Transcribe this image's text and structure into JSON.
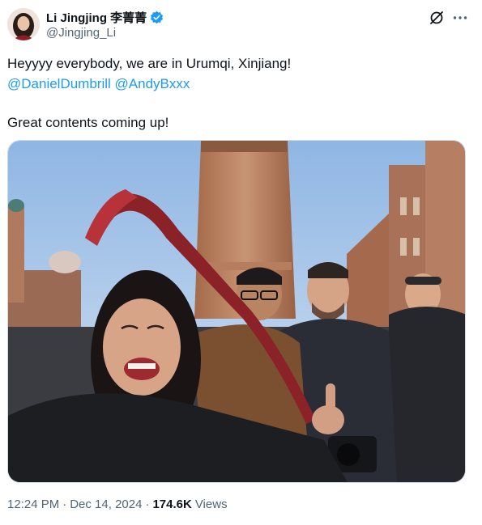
{
  "author": {
    "display_name": "Li Jingjing 李菁菁",
    "handle": "@Jingjing_Li",
    "verified_color": "#1d9bf0"
  },
  "actions": {
    "grok_icon": "grok-icon",
    "more_icon": "more-icon"
  },
  "tweet": {
    "line1": "Heyyyy everybody, we are in Urumqi, Xinjiang!",
    "mention1": "@DanielDumbrill",
    "mention2": "@AndyBxxx",
    "line3": "Great contents coming up!"
  },
  "meta": {
    "time": "12:24 PM",
    "separator1": "·",
    "date": "Dec 14, 2024",
    "separator2": "·",
    "views_count": "174.6K",
    "views_label": "Views"
  },
  "colors": {
    "link": "#1d9bf0",
    "text": "#0f1419",
    "secondary": "#536471"
  }
}
